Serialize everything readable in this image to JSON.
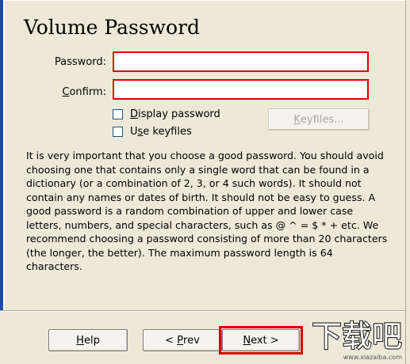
{
  "wizard": {
    "title": "Volume Password"
  },
  "form": {
    "password_label": "Password:",
    "password_value": "",
    "confirm_label_accel": "C",
    "confirm_label_rest": "onfirm:",
    "confirm_value": ""
  },
  "options": {
    "display_password_accel": "D",
    "display_password_rest": "isplay password",
    "display_password_checked": false,
    "use_keyfiles_prefix": "U",
    "use_keyfiles_accel": "s",
    "use_keyfiles_rest": "e keyfiles",
    "use_keyfiles_checked": false,
    "keyfiles_button_accel": "K",
    "keyfiles_button_rest": "eyfiles..."
  },
  "help": {
    "text": "It is very important that you choose a good password. You should avoid choosing one that contains only a single word that can be found in a dictionary (or a combination of 2, 3, or 4 such words). It should not contain any names or dates of birth. It should not be easy to guess. A good password is a random combination of upper and lower case letters, numbers, and special characters, such as @ ^ = $ * + etc. We recommend choosing a password consisting of more than 20 characters (the longer, the better). The maximum password length is 64 characters."
  },
  "nav": {
    "help_accel": "H",
    "help_rest": "elp",
    "prev_prefix": "< ",
    "prev_accel": "P",
    "prev_rest": "rev",
    "next_accel": "N",
    "next_rest": "ext >"
  },
  "watermark": {
    "brand": "下载吧",
    "url": "www.xiazaiba.com"
  }
}
